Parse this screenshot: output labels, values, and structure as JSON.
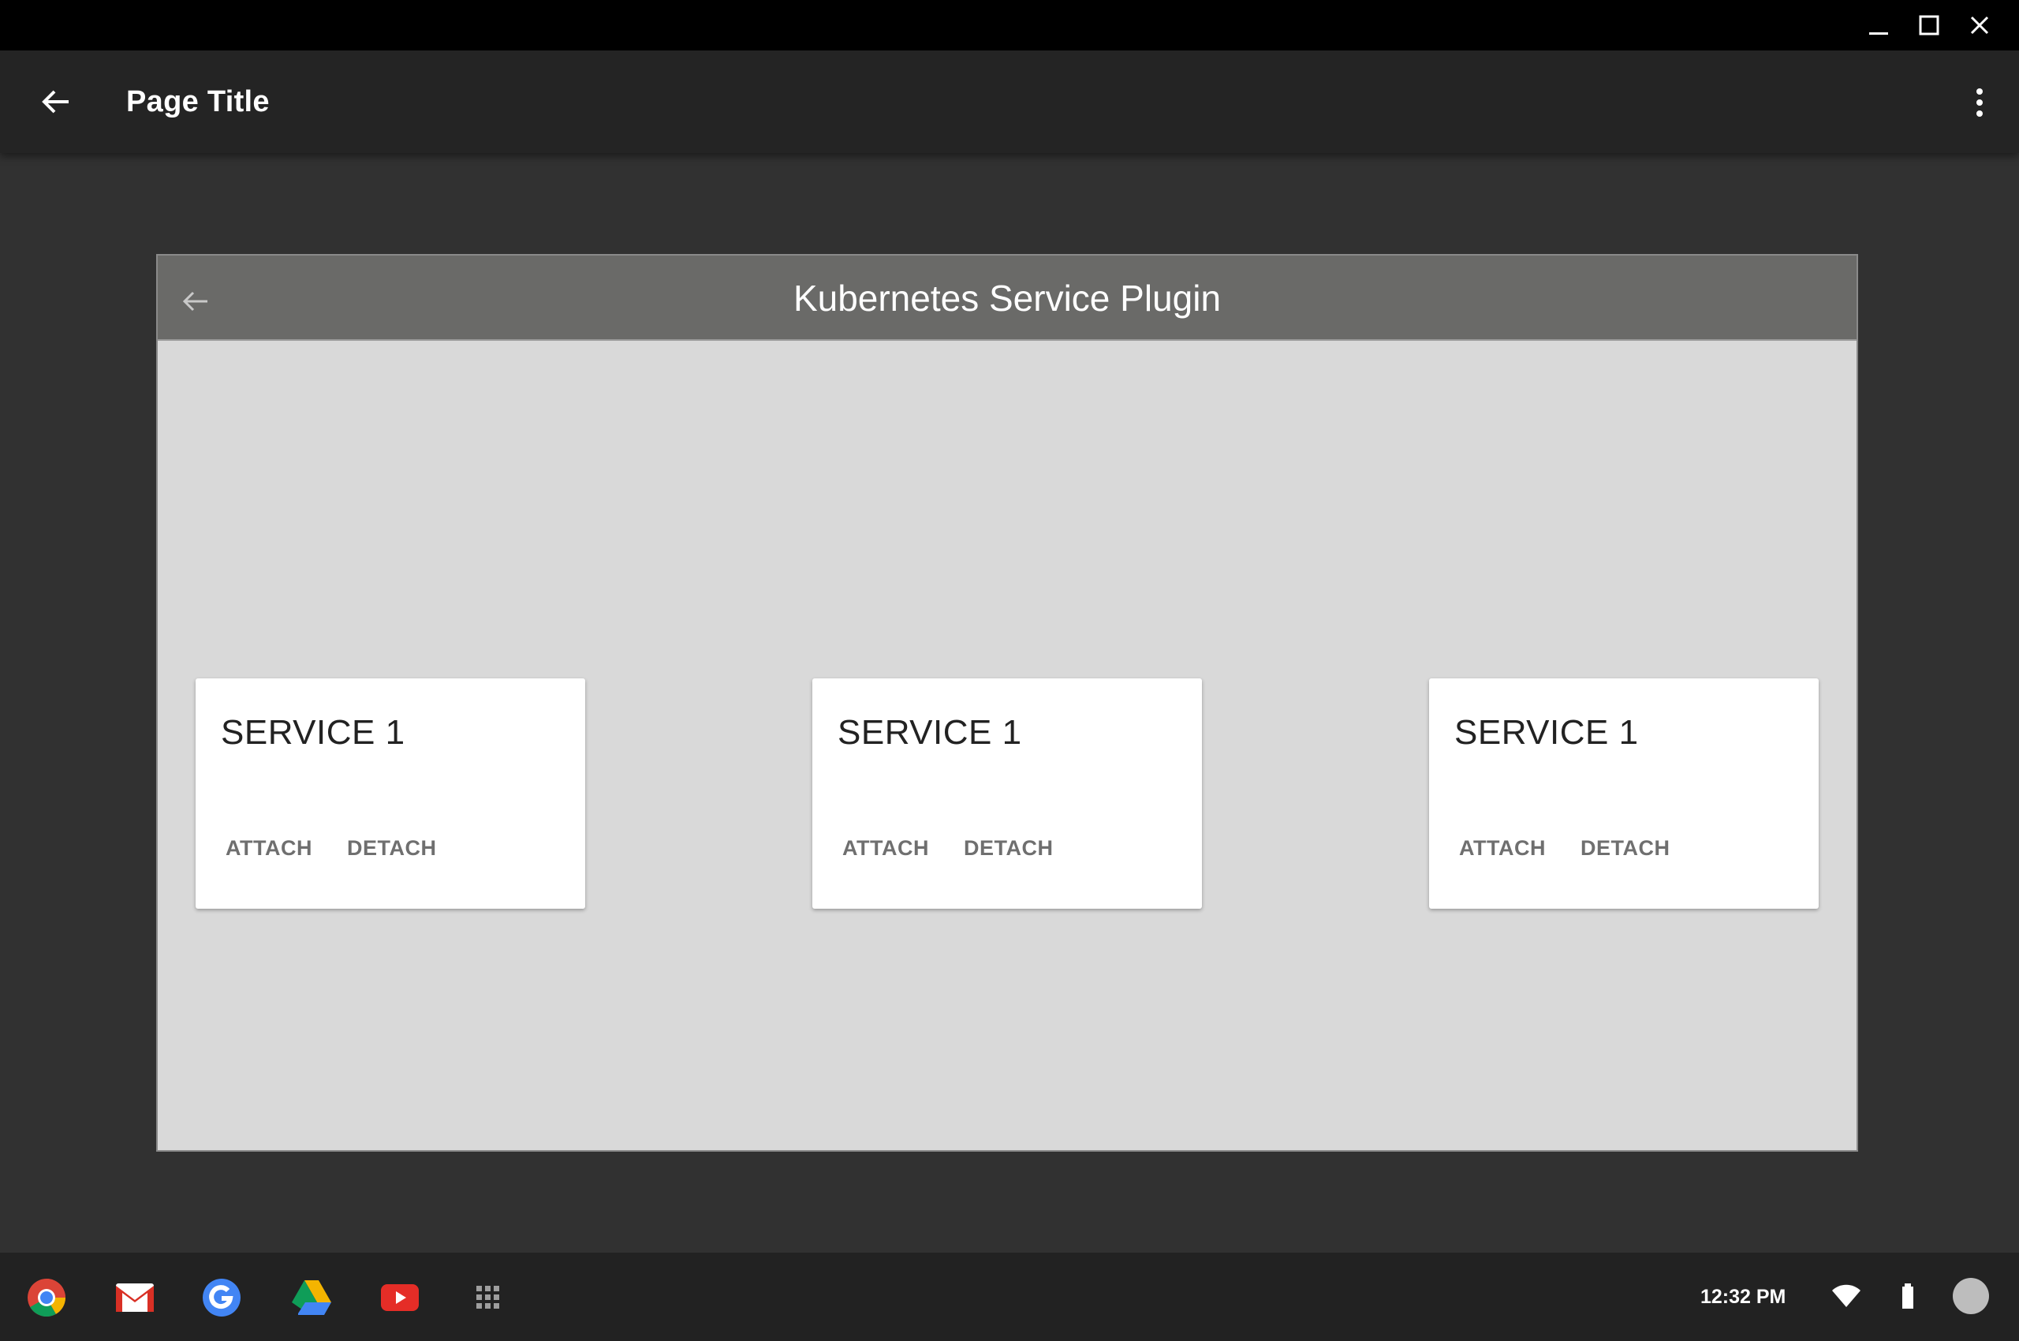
{
  "appbar": {
    "title": "Page Title"
  },
  "panel": {
    "title": "Kubernetes Service Plugin"
  },
  "cards": [
    {
      "title": "SERVICE 1",
      "attach_label": "ATTACH",
      "detach_label": "DETACH"
    },
    {
      "title": "SERVICE 1",
      "attach_label": "ATTACH",
      "detach_label": "DETACH"
    },
    {
      "title": "SERVICE 1",
      "attach_label": "ATTACH",
      "detach_label": "DETACH"
    }
  ],
  "shelf": {
    "apps": [
      "chrome-icon",
      "gmail-icon",
      "google-icon",
      "drive-icon",
      "youtube-icon",
      "app-launcher-icon"
    ],
    "clock": "12:32 PM"
  },
  "colors": {
    "background": "#313131",
    "titlebar": "#000000",
    "appbar": "#242424",
    "panel_header": "#6a6a68",
    "panel_body": "#d9d9d9",
    "card": "#ffffff",
    "button_text": "#6f6f6f"
  }
}
